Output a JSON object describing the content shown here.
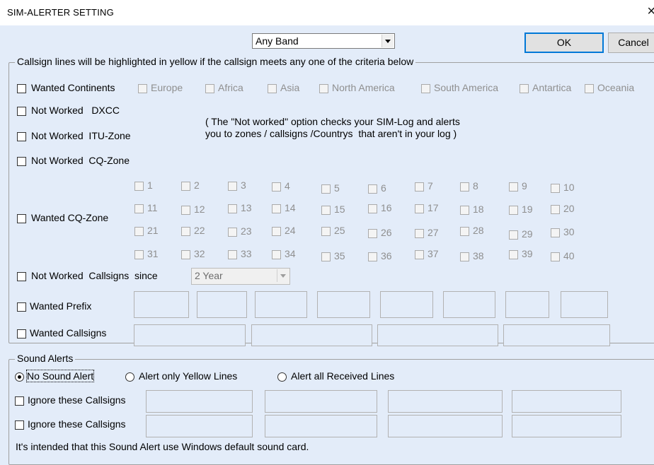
{
  "window": {
    "title": "SIM-ALERTER   SETTING",
    "close_glyph": "×"
  },
  "band_select": {
    "value": "Any Band"
  },
  "buttons": {
    "ok": "OK",
    "cancel": "Cancel"
  },
  "highlight_group": {
    "legend": "Callsign lines will be highlighted in yellow if the callsign meets any one of the criteria below",
    "wanted_continents": {
      "label": "Wanted Continents",
      "options": [
        "Europe",
        "Africa",
        "Asia",
        "North America",
        "South America",
        "Antartica",
        "Oceania"
      ]
    },
    "not_worked_dxcc": "Not Worked   DXCC",
    "note": [
      "( The \"Not worked\" option checks your SIM-Log and alerts",
      "you to zones / callsigns /Countrys  that aren't in your log )"
    ],
    "not_worked_itu": "Not Worked  ITU-Zone",
    "not_worked_cq": "Not Worked  CQ-Zone",
    "wanted_cq": "Wanted CQ-Zone",
    "zones": [
      "1",
      "2",
      "3",
      "4",
      "5",
      "6",
      "7",
      "8",
      "9",
      "10",
      "11",
      "12",
      "13",
      "14",
      "15",
      "16",
      "17",
      "18",
      "19",
      "20",
      "21",
      "22",
      "23",
      "24",
      "25",
      "26",
      "27",
      "28",
      "29",
      "30",
      "31",
      "32",
      "33",
      "34",
      "35",
      "36",
      "37",
      "38",
      "39",
      "40"
    ],
    "not_worked_callsigns": "Not Worked  Callsigns  since",
    "since_select": "2 Year",
    "wanted_prefix": "Wanted Prefix",
    "wanted_callsigns": "Wanted Callsigns"
  },
  "sound_group": {
    "legend": "Sound Alerts",
    "radio": [
      "No Sound Alert",
      "Alert only Yellow Lines",
      "Alert all Received Lines"
    ],
    "ignore_1": "Ignore these Callsigns",
    "ignore_2": "Ignore these Callsigns",
    "footer": "It's intended that this Sound Alert use Windows default sound card."
  }
}
